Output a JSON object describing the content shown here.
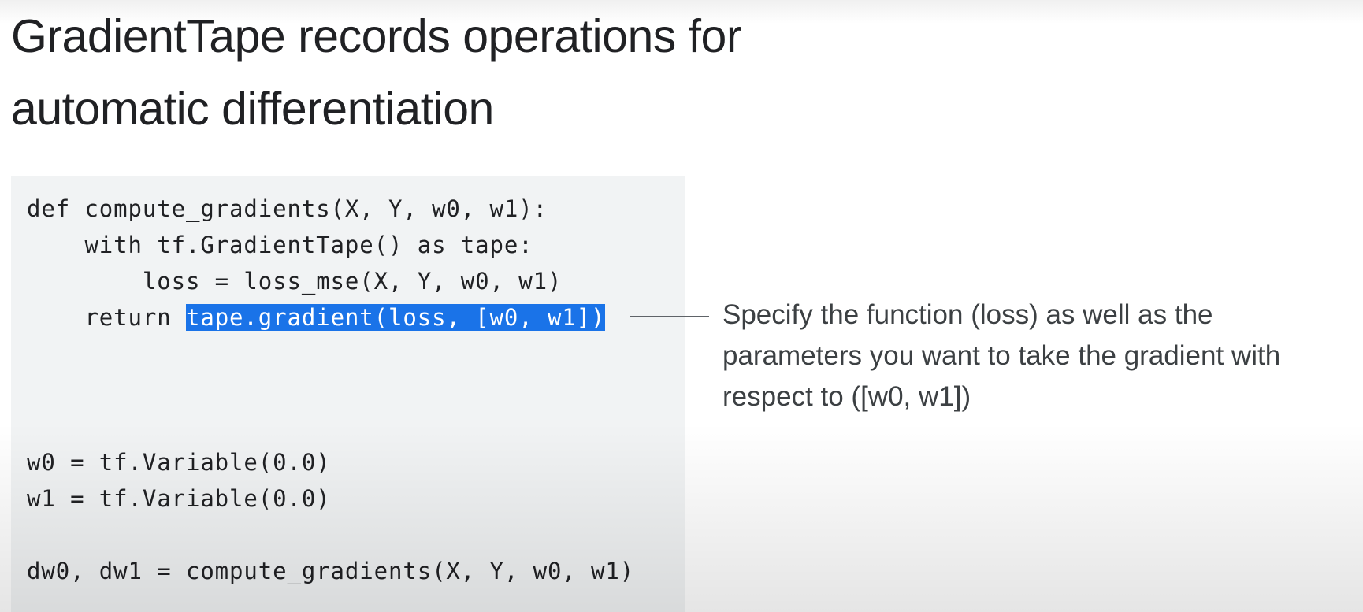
{
  "slide": {
    "title_lines": [
      "GradientTape records operations for",
      "automatic differentiation"
    ],
    "code": {
      "line1": "def compute_gradients(X, Y, w0, w1):",
      "line2": "    with tf.GradientTape() as tape:",
      "line3": "        loss = loss_mse(X, Y, w0, w1)",
      "line4_prefix": "    return ",
      "line4_highlight": "tape.gradient(loss, [w0, w1])",
      "line5": "w0 = tf.Variable(0.0)",
      "line6": "w1 = tf.Variable(0.0)",
      "line7": "dw0, dw1 = compute_gradients(X, Y, w0, w1)"
    },
    "callout_lines": [
      "Specify the function (loss) as well as the",
      "parameters you want to take the gradient with",
      "respect to ([w0, w1])"
    ],
    "colors": {
      "highlight": "#1a73e8",
      "code_background": "#f1f3f4",
      "text": "#202124"
    }
  }
}
